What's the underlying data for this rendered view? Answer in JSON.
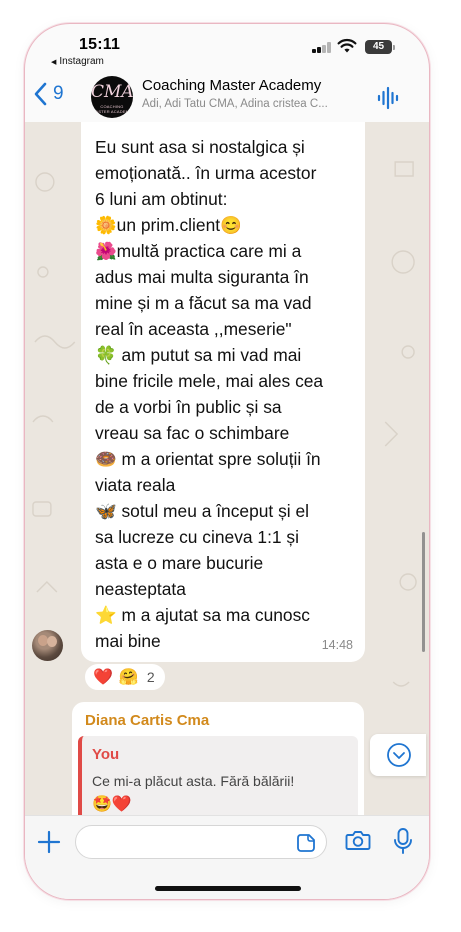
{
  "status_bar": {
    "time": "15:11",
    "back_app": "Instagram",
    "battery": "45"
  },
  "header": {
    "back_count": "9",
    "title": "Coaching Master Academy",
    "subtitle": "Adi, Adi Tatu CMA, Adina cristea C...",
    "avatar_logo": "CMA",
    "avatar_logo_sub": "COACHING MASTER ACADEMY"
  },
  "message": {
    "lines": [
      "Eu sunt asa si nostalgica și",
      "emoționată.. în urma acestor",
      "6 luni am obtinut:",
      "🌼un prim.client😊",
      "🌺multă practica care mi a",
      "adus mai multa siguranta în",
      "mine și m a făcut sa ma vad",
      "real în aceasta ,,meserie\"",
      "🍀 am putut sa mi vad mai",
      "bine fricile mele, mai ales cea",
      "de a vorbi în public și sa",
      "vreau sa fac o schimbare",
      "🍩 m a orientat spre soluții în",
      "viata reala",
      "🦋 sotul meu a început și el",
      "sa lucreze cu cineva 1:1 și",
      "asta e o mare bucurie",
      "neasteptata",
      "⭐ m a ajutat sa ma cunosc",
      "mai bine"
    ],
    "time": "14:48",
    "reactions": [
      "❤️",
      "🤗"
    ],
    "reaction_count": "2"
  },
  "reply_message": {
    "sender": "Diana Cartis Cma",
    "quote_author": "You",
    "quote_text": "Ce mi-a plăcut asta. Fără bălării!",
    "quote_emoji": "🤩❤️"
  },
  "input": {
    "placeholder": ""
  },
  "colors": {
    "accent_blue": "#1f75d1",
    "sender_name": "#d28a1d",
    "quote_author": "#e04a46",
    "chat_bg": "#ebe6df"
  }
}
